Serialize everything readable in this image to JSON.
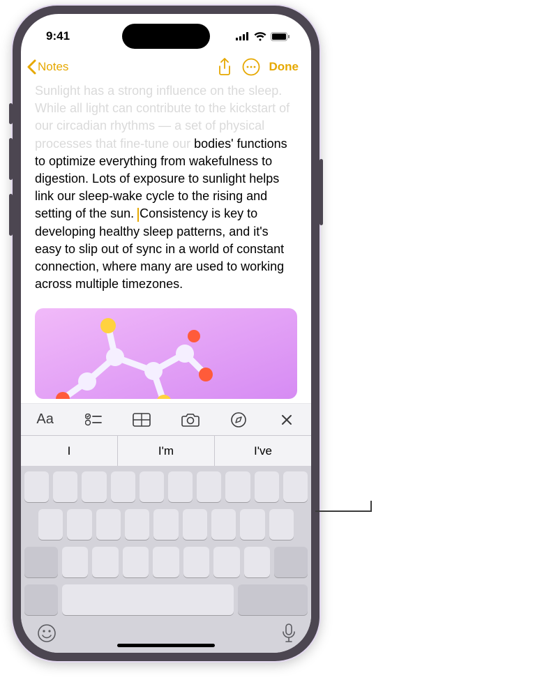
{
  "status": {
    "time": "9:41"
  },
  "nav": {
    "back_label": "Notes",
    "done_label": "Done"
  },
  "note": {
    "faded_text": "Sunlight has a strong influence on the sleep. While all light can contribute to the kickstart of our circadian rhythms — a set of physical processes that fine-tune our ",
    "body_a": "bodies' functions to optimize everything from wakefulness to digestion. Lots of exposure to sunlight helps link our sleep-wake cycle to the rising and setting of the sun. ",
    "body_b": "Consistency is key to developing healthy sleep patterns, and it's easy to slip out of sync in a world of constant connection, where many are used to working across multiple timezones."
  },
  "suggestions": {
    "s1": "I",
    "s2": "I'm",
    "s3": "I've"
  },
  "icons": {
    "format": "Aa",
    "checklist": "checklist-icon",
    "table": "table-icon",
    "camera": "camera-icon",
    "markup": "markup-icon",
    "close": "close-icon"
  }
}
